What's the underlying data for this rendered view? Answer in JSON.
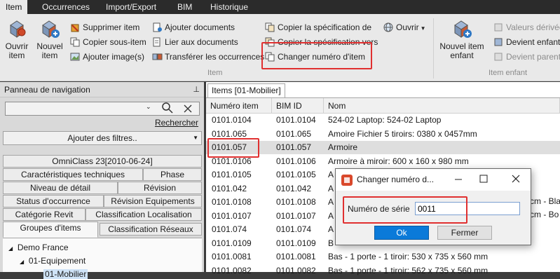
{
  "menu": {
    "tabs": [
      "Item",
      "Occurrences",
      "Import/Export",
      "BIM",
      "Historique"
    ]
  },
  "ribbon": {
    "ouvrir_item": [
      "Ouvrir",
      "item"
    ],
    "nouvel_item": [
      "Nouvel",
      "item"
    ],
    "col1": [
      "Supprimer item",
      "Copier sous-item",
      "Ajouter image(s)"
    ],
    "col2": [
      "Ajouter documents",
      "Lier aux documents",
      "Transférer les occurrences"
    ],
    "col3": [
      "Copier la spécification de",
      "Copier la spécification vers",
      "Changer numéro d'item"
    ],
    "ouvrir_menu": "Ouvrir",
    "nouvel_item_enfant": [
      "Nouvel item",
      "enfant"
    ],
    "col5": [
      "Valeurs dérivée",
      "Devient enfant",
      "Devient parent"
    ],
    "group_item": "Item",
    "group_enfant": "Item enfant"
  },
  "nav": {
    "title": "Panneau de navigation",
    "search_value": "",
    "rechercher": "Rechercher",
    "filter_label": "Ajouter des filtres..",
    "tab_rows": [
      [
        "OmniClass 23[2010-06-24]"
      ],
      [
        "Caractéristiques techniques",
        "Phase"
      ],
      [
        "Niveau de détail",
        "Révision"
      ],
      [
        "Status d'occurrence",
        "Révision Equipements"
      ],
      [
        "Catégorie Revit",
        "Classification Localisation"
      ],
      [
        "Groupes d'items",
        "Classification Réseaux"
      ]
    ],
    "tree": [
      "Demo France",
      "01-Equipement",
      "01-Mobilier"
    ]
  },
  "main": {
    "tab_label": "Items [01-Mobilier]",
    "columns": [
      "Numéro item",
      "BIM ID",
      "Nom"
    ],
    "rows": [
      [
        "0101.0104",
        "0101.0104",
        "524-02 Laptop: 524-02 Laptop"
      ],
      [
        "0101.065",
        "0101.065",
        "Amoire Fichier 5 tiroirs: 0380 x 0457mm"
      ],
      [
        "0101.057",
        "0101.057",
        "Armoire"
      ],
      [
        "0101.0106",
        "0101.0106",
        "Armoire à miroir: 600 x 160 x 980 mm"
      ],
      [
        "0101.0105",
        "0101.0105",
        "A"
      ],
      [
        "0101.042",
        "0101.042",
        "A"
      ],
      [
        "0101.0108",
        "0101.0108",
        "A"
      ],
      [
        "0101.0107",
        "0101.0107",
        "A"
      ],
      [
        "0101.074",
        "0101.074",
        "A"
      ],
      [
        "0101.0109",
        "0101.0109",
        "B"
      ],
      [
        "0101.0081",
        "0101.0081",
        "Bas - 1 porte - 1 tiroir: 530 x 735 x 560 mm"
      ],
      [
        "0101.0082",
        "0101.0082",
        "Bas - 1 porte - 1 tiroir: 562 x 735 x 560 mm"
      ]
    ],
    "right_peek": [
      "cm - Bla",
      "cm - Bo"
    ]
  },
  "dialog": {
    "title": "Changer numéro d...",
    "field_label": "Numéro de série",
    "field_value": "0011",
    "ok": "Ok",
    "cancel": "Fermer"
  },
  "colors": {
    "highlight": "#e03030",
    "accent": "#0a7ad9",
    "menubar": "#2b2b2b"
  }
}
